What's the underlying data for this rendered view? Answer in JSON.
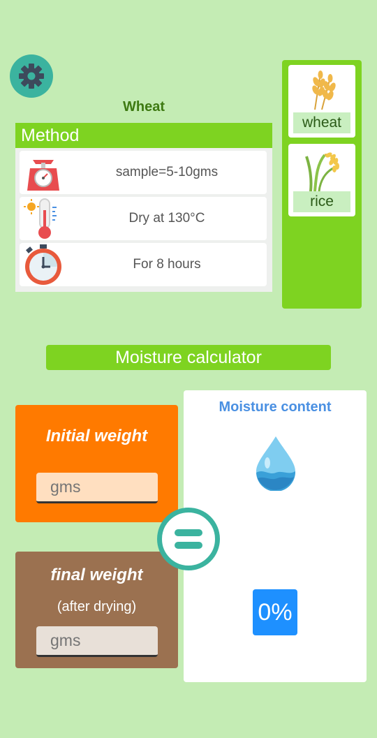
{
  "crop_title": "Wheat",
  "method": {
    "header": "Method",
    "steps": [
      {
        "icon": "scale-icon",
        "text": "sample=5-10gms"
      },
      {
        "icon": "thermometer-icon",
        "text": "Dry at 130°C"
      },
      {
        "icon": "stopwatch-icon",
        "text": "For 8 hours"
      }
    ]
  },
  "crops": [
    {
      "icon": "wheat-icon",
      "label": "wheat"
    },
    {
      "icon": "rice-icon",
      "label": "rice"
    }
  ],
  "calculator": {
    "title": "Moisture calculator",
    "initial": {
      "title": "Initial weight",
      "placeholder": "gms"
    },
    "final": {
      "title": "final weight",
      "subtitle": "(after drying)",
      "placeholder": "gms"
    },
    "result": {
      "title": "Moisture content",
      "value": "0%"
    }
  },
  "colors": {
    "background": "#c4ecb4",
    "accent_green": "#7ed321",
    "teal": "#3bb39f",
    "orange": "#ff7a00",
    "brown": "#9b7150",
    "blue": "#1e90ff"
  }
}
